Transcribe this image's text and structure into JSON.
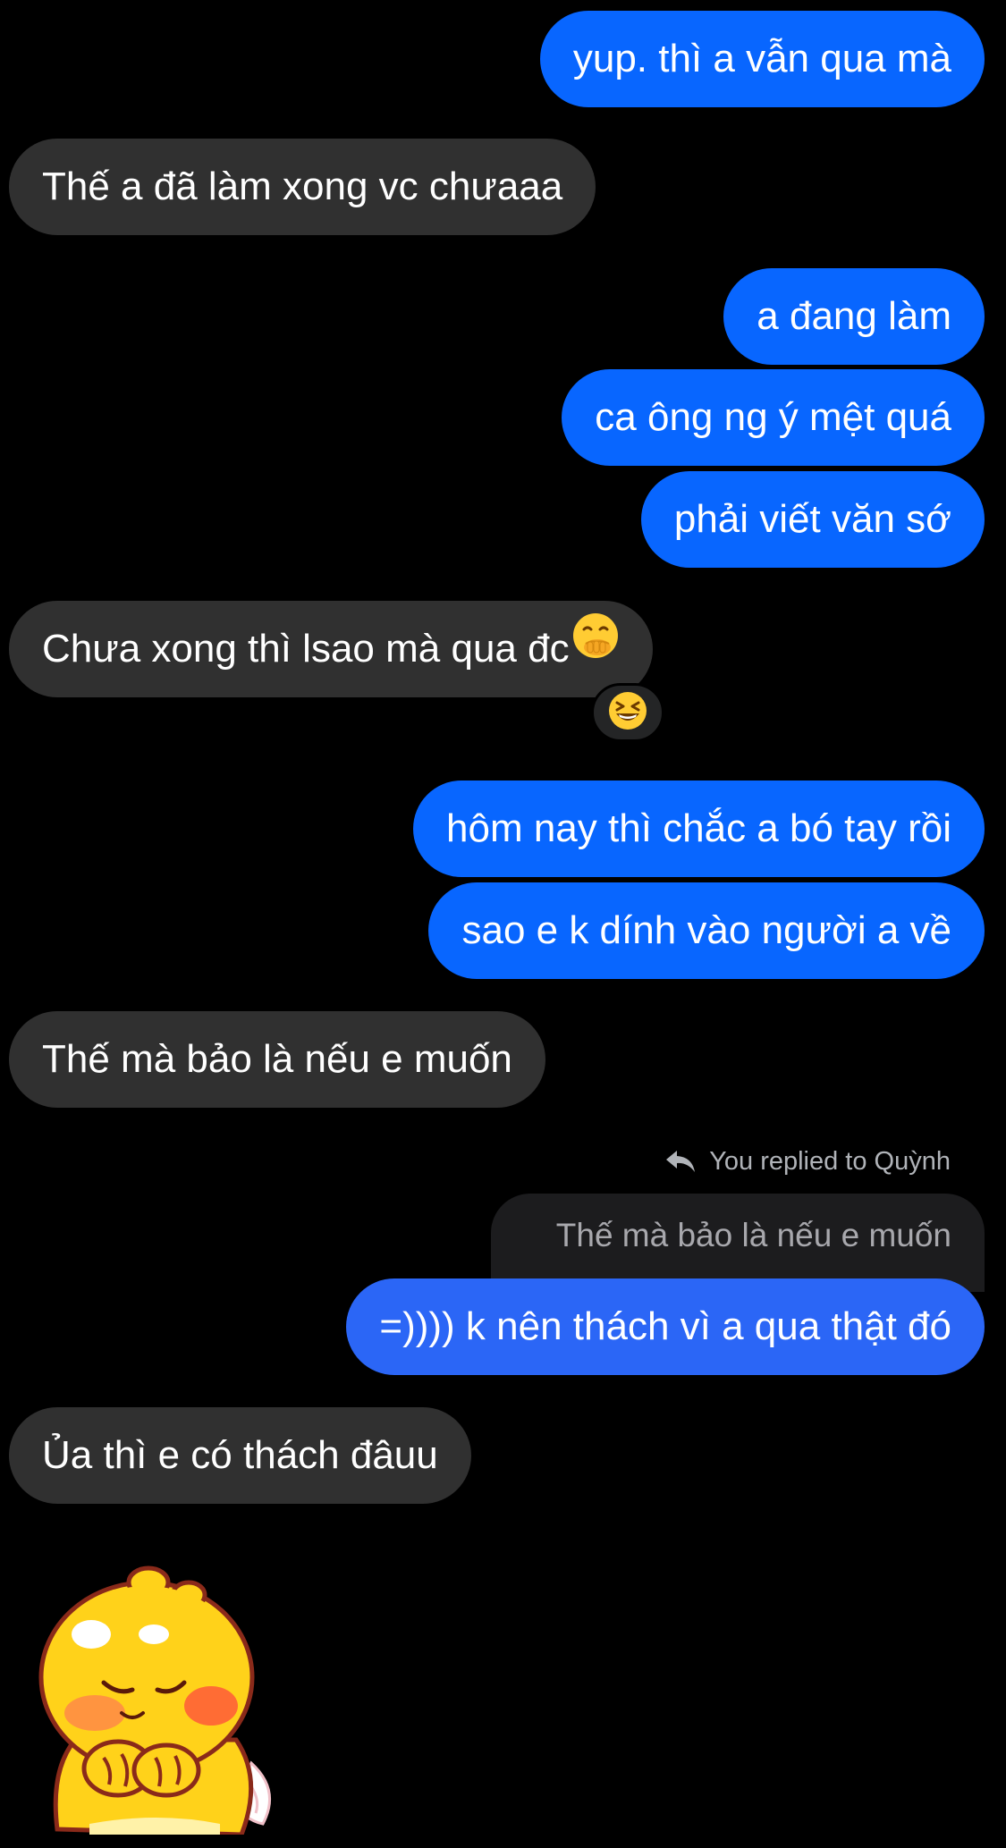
{
  "messages": [
    {
      "id": "m1",
      "direction": "outgoing",
      "text": "yup. thì a vẫn qua mà"
    },
    {
      "id": "m2",
      "direction": "incoming",
      "text": "Thế a đã làm xong vc chưaaa"
    },
    {
      "id": "m3",
      "direction": "outgoing",
      "text": "a đang làm"
    },
    {
      "id": "m4",
      "direction": "outgoing",
      "text": "ca ông ng ý mệt quá"
    },
    {
      "id": "m5",
      "direction": "outgoing",
      "text": "phải viết văn sớ"
    },
    {
      "id": "m6",
      "direction": "incoming",
      "text": "Chưa xong thì lsao mà qua đc",
      "inline_emoji": "face-with-hand-over-mouth",
      "reaction": "grinning-squinting-face"
    },
    {
      "id": "m7",
      "direction": "outgoing",
      "text": "hôm nay thì chắc a bó tay rồi"
    },
    {
      "id": "m8",
      "direction": "outgoing",
      "text": "sao e k dính vào người a về"
    },
    {
      "id": "m9",
      "direction": "incoming",
      "text": "Thế mà bảo là nếu e muốn"
    },
    {
      "id": "m10",
      "direction": "outgoing",
      "text": "=)))) k nên thách vì a qua thật đó",
      "reply_header": "You replied to Quỳnh",
      "quoted_text": "Thế mà bảo là nếu e muốn"
    },
    {
      "id": "m11",
      "direction": "incoming",
      "text": "Ủa thì e có thách đâuu"
    },
    {
      "id": "m12",
      "direction": "incoming",
      "sticker": "yellow-chick-sticker"
    }
  ],
  "colors": {
    "background": "#000000",
    "outgoing_bubble": "#0866ff",
    "incoming_bubble": "#303030",
    "quoted_bubble": "#1c1c1e",
    "meta_text": "#b0b3b8"
  },
  "icons": {
    "reply": "reply-arrow-icon"
  }
}
